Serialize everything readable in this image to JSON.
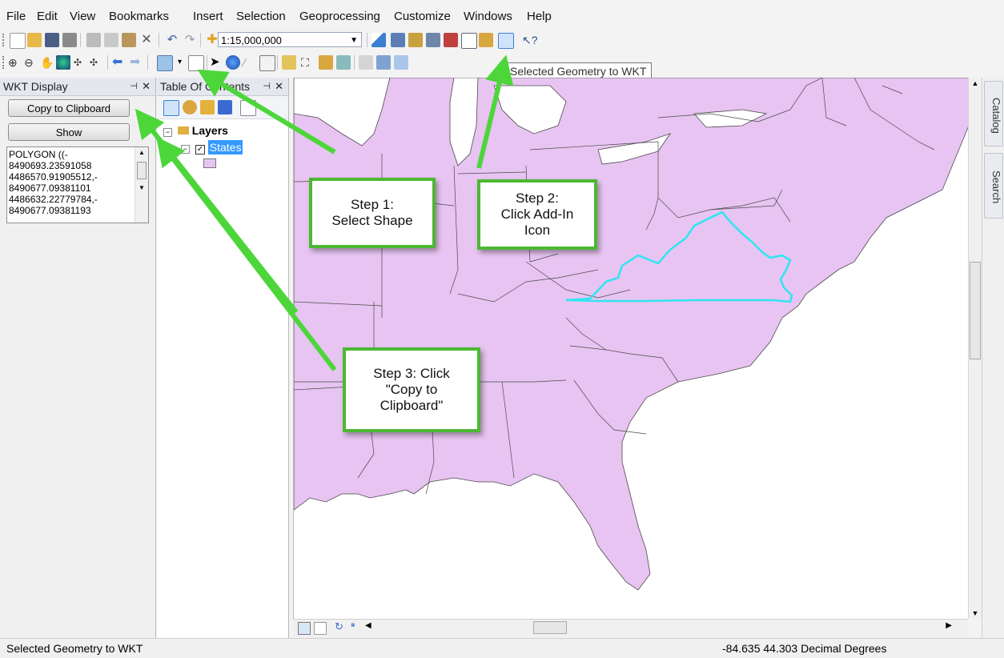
{
  "menu": [
    "File",
    "Edit",
    "View",
    "Bookmarks",
    "Insert",
    "Selection",
    "Geoprocessing",
    "Customize",
    "Windows",
    "Help"
  ],
  "toolbar": {
    "scale_value": "1:15,000,000"
  },
  "tooltip": "Selected Geometry to WKT",
  "wkt_panel": {
    "title": "WKT Display",
    "copy_button": "Copy to Clipboard",
    "show_button": "Show",
    "wkt_lines": [
      "POLYGON ((-",
      "8490693.23591058",
      "4486570.91905512,-",
      "8490677.09381101",
      "4486632.22779784,-",
      "8490677.09381193"
    ]
  },
  "toc": {
    "title": "Table Of Contents",
    "layers_label": "Layers",
    "states_label": "States"
  },
  "side_tabs": [
    "Catalog",
    "Search"
  ],
  "callouts": {
    "step1": "Step 1:\nSelect Shape",
    "step2": "Step 2:\nClick Add-In\nIcon",
    "step3": "Step 3: Click\n\"Copy to\nClipboard\""
  },
  "status": {
    "left": "Selected Geometry to WKT",
    "coords": "-84.635  44.303 Decimal Degrees"
  },
  "colors": {
    "state_fill": "#e8c4f2",
    "highlight": "#2ee6f0",
    "arrow": "#4cd63a",
    "callout_border": "#4cb832"
  }
}
